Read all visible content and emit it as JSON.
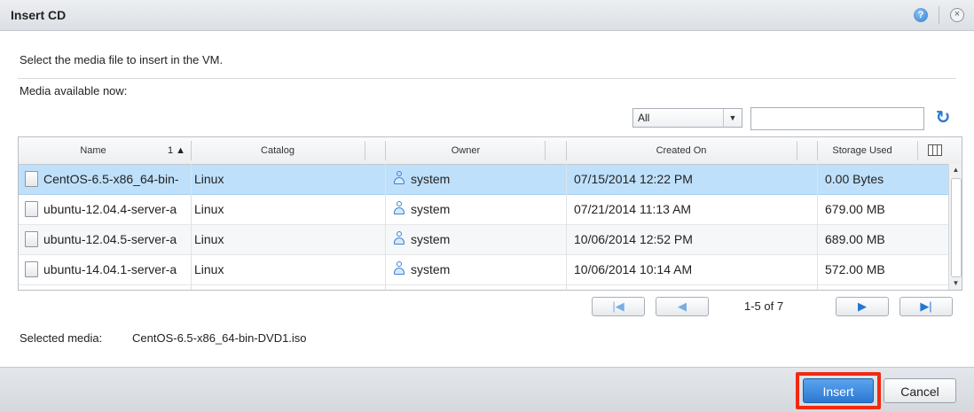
{
  "dialog": {
    "title": "Insert CD",
    "help_glyph": "?",
    "close_glyph": "×"
  },
  "instruction": "Select the media file to insert in the VM.",
  "media_label": "Media available now:",
  "filter": {
    "selected": "All",
    "arrow": "▼"
  },
  "search": {
    "value": "",
    "placeholder": ""
  },
  "refresh_glyph": "↻",
  "table": {
    "columns": [
      "Name",
      "Catalog",
      "Owner",
      "Created On",
      "Storage Used"
    ],
    "sort_indicator": "1 ▲",
    "rows": [
      {
        "name": "CentOS-6.5-x86_64-bin-",
        "catalog": "Linux",
        "owner": "system",
        "created": "07/15/2014 12:22 PM",
        "storage": "0.00 Bytes"
      },
      {
        "name": "ubuntu-12.04.4-server-a",
        "catalog": "Linux",
        "owner": "system",
        "created": "07/21/2014 11:13 AM",
        "storage": "679.00 MB"
      },
      {
        "name": "ubuntu-12.04.5-server-a",
        "catalog": "Linux",
        "owner": "system",
        "created": "10/06/2014 12:52 PM",
        "storage": "689.00 MB"
      },
      {
        "name": "ubuntu-14.04.1-server-a",
        "catalog": "Linux",
        "owner": "system",
        "created": "10/06/2014 10:14 AM",
        "storage": "572.00 MB"
      }
    ],
    "selected_row": 0
  },
  "pager": {
    "first_glyph": "|◀",
    "prev_glyph": "◀",
    "next_glyph": "▶",
    "last_glyph": "▶|",
    "info": "1-5 of 7"
  },
  "selected_media": {
    "label": "Selected media:",
    "value": "CentOS-6.5-x86_64-bin-DVD1.iso"
  },
  "buttons": {
    "insert": "Insert",
    "cancel": "Cancel"
  },
  "colors": {
    "selected_row": "#bfe0fb",
    "primary_button": "#2c78d2",
    "highlight": "#ef2a12"
  }
}
